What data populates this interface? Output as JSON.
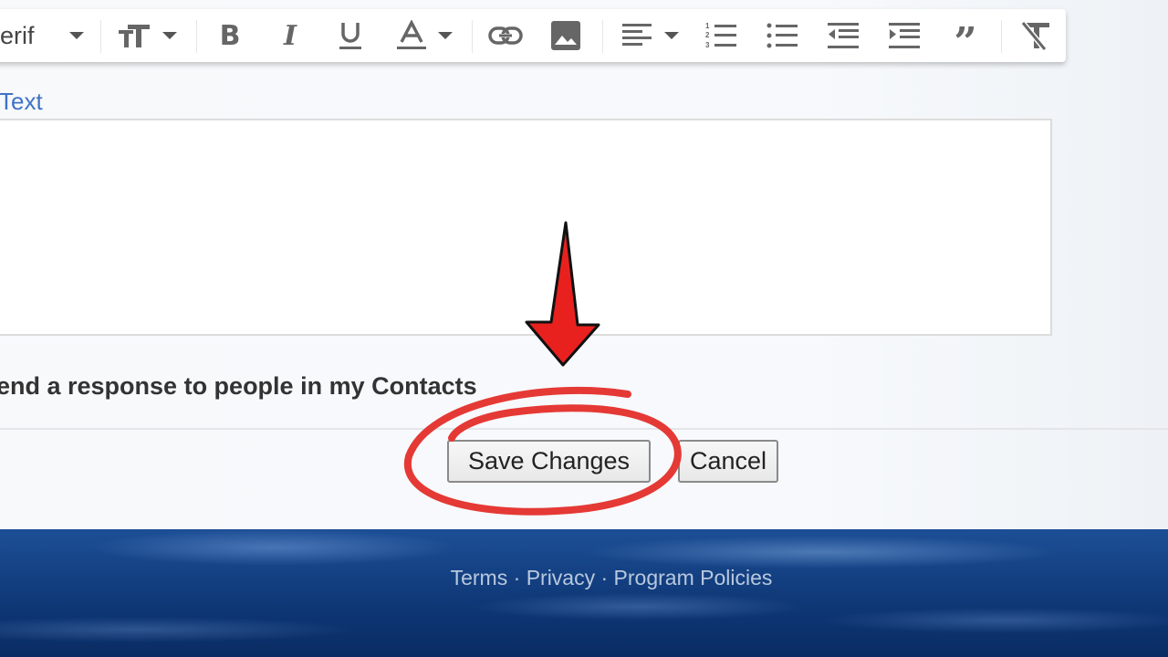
{
  "toolbar": {
    "font_name": "erif",
    "items": [
      "font-size",
      "bold",
      "italic",
      "underline",
      "text-color",
      "link",
      "image",
      "align",
      "numbered-list",
      "bulleted-list",
      "indent-less",
      "indent-more",
      "quote",
      "remove-formatting"
    ],
    "icon_color": "#666666"
  },
  "form": {
    "label": "Text",
    "textarea_value": "",
    "contacts_option": "end a response to people in my Contacts"
  },
  "buttons": {
    "save": "Save Changes",
    "cancel": "Cancel"
  },
  "footer": {
    "terms": "Terms",
    "sep": " · ",
    "privacy": "Privacy",
    "policies": "Program Policies"
  },
  "annotation": {
    "color": "#e53935",
    "target": "Save Changes"
  }
}
